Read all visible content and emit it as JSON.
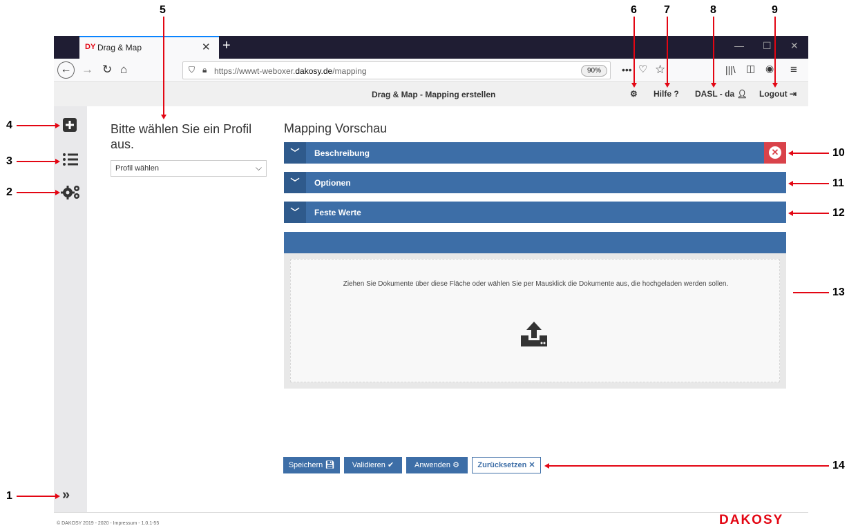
{
  "callouts": [
    "1",
    "2",
    "3",
    "4",
    "5",
    "6",
    "7",
    "8",
    "9",
    "10",
    "11",
    "12",
    "13",
    "14"
  ],
  "browser": {
    "tab_favicon": "DY",
    "tab_title": "Drag & Map",
    "url_prefix": "https://wwwt-weboxer.",
    "url_domain": "dakosy.de",
    "url_path": "/mapping",
    "zoom": "90%"
  },
  "header": {
    "title": "Drag & Map - Mapping erstellen",
    "help": "Hilfe",
    "user": "DASL - da",
    "logout": "Logout"
  },
  "profile": {
    "title": "Bitte wählen Sie ein Profil aus.",
    "select_value": "Profil wählen"
  },
  "preview": {
    "title": "Mapping Vorschau",
    "sections": [
      "Beschreibung",
      "Optionen",
      "Feste Werte"
    ]
  },
  "upload": {
    "text": "Ziehen Sie Dokumente über diese Fläche oder wählen Sie per Mausklick die Dokumente aus, die hochgeladen werden sollen."
  },
  "actions": {
    "save": "Speichern",
    "validate": "Validieren",
    "apply": "Anwenden",
    "reset": "Zurücksetzen"
  },
  "footer": {
    "text": "© DAKOSY 2019 - 2020 - Impressum - 1.0.1-55",
    "logo": "DAKOSY"
  },
  "colors": {
    "accent_blue": "#3d6ea7",
    "close_red": "#d9424a",
    "callout_red": "#e30613",
    "brand_red": "#e30613"
  }
}
